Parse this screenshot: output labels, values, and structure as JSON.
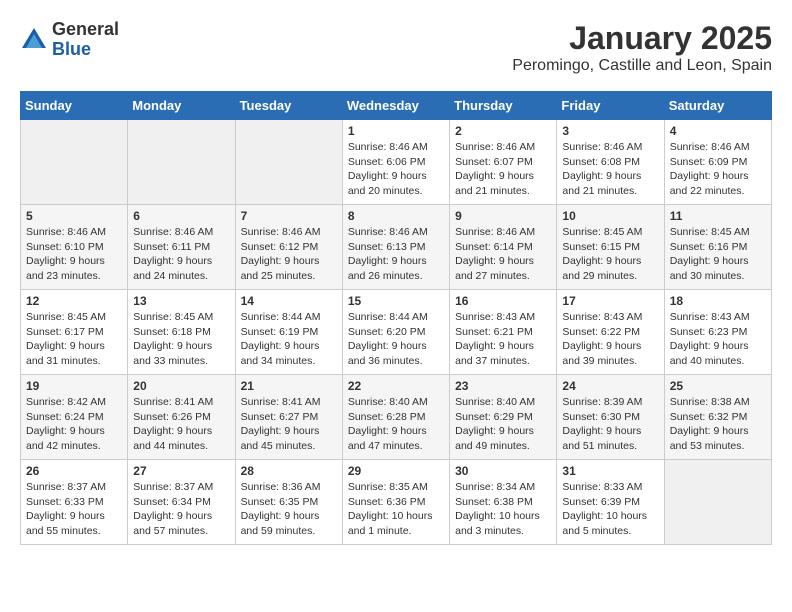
{
  "header": {
    "logo_general": "General",
    "logo_blue": "Blue",
    "month_title": "January 2025",
    "location": "Peromingo, Castille and Leon, Spain"
  },
  "weekdays": [
    "Sunday",
    "Monday",
    "Tuesday",
    "Wednesday",
    "Thursday",
    "Friday",
    "Saturday"
  ],
  "weeks": [
    [
      {
        "day": "",
        "sunrise": "",
        "sunset": "",
        "daylight": "",
        "empty": true
      },
      {
        "day": "",
        "sunrise": "",
        "sunset": "",
        "daylight": "",
        "empty": true
      },
      {
        "day": "",
        "sunrise": "",
        "sunset": "",
        "daylight": "",
        "empty": true
      },
      {
        "day": "1",
        "sunrise": "Sunrise: 8:46 AM",
        "sunset": "Sunset: 6:06 PM",
        "daylight": "Daylight: 9 hours and 20 minutes.",
        "empty": false
      },
      {
        "day": "2",
        "sunrise": "Sunrise: 8:46 AM",
        "sunset": "Sunset: 6:07 PM",
        "daylight": "Daylight: 9 hours and 21 minutes.",
        "empty": false
      },
      {
        "day": "3",
        "sunrise": "Sunrise: 8:46 AM",
        "sunset": "Sunset: 6:08 PM",
        "daylight": "Daylight: 9 hours and 21 minutes.",
        "empty": false
      },
      {
        "day": "4",
        "sunrise": "Sunrise: 8:46 AM",
        "sunset": "Sunset: 6:09 PM",
        "daylight": "Daylight: 9 hours and 22 minutes.",
        "empty": false
      }
    ],
    [
      {
        "day": "5",
        "sunrise": "Sunrise: 8:46 AM",
        "sunset": "Sunset: 6:10 PM",
        "daylight": "Daylight: 9 hours and 23 minutes.",
        "empty": false
      },
      {
        "day": "6",
        "sunrise": "Sunrise: 8:46 AM",
        "sunset": "Sunset: 6:11 PM",
        "daylight": "Daylight: 9 hours and 24 minutes.",
        "empty": false
      },
      {
        "day": "7",
        "sunrise": "Sunrise: 8:46 AM",
        "sunset": "Sunset: 6:12 PM",
        "daylight": "Daylight: 9 hours and 25 minutes.",
        "empty": false
      },
      {
        "day": "8",
        "sunrise": "Sunrise: 8:46 AM",
        "sunset": "Sunset: 6:13 PM",
        "daylight": "Daylight: 9 hours and 26 minutes.",
        "empty": false
      },
      {
        "day": "9",
        "sunrise": "Sunrise: 8:46 AM",
        "sunset": "Sunset: 6:14 PM",
        "daylight": "Daylight: 9 hours and 27 minutes.",
        "empty": false
      },
      {
        "day": "10",
        "sunrise": "Sunrise: 8:45 AM",
        "sunset": "Sunset: 6:15 PM",
        "daylight": "Daylight: 9 hours and 29 minutes.",
        "empty": false
      },
      {
        "day": "11",
        "sunrise": "Sunrise: 8:45 AM",
        "sunset": "Sunset: 6:16 PM",
        "daylight": "Daylight: 9 hours and 30 minutes.",
        "empty": false
      }
    ],
    [
      {
        "day": "12",
        "sunrise": "Sunrise: 8:45 AM",
        "sunset": "Sunset: 6:17 PM",
        "daylight": "Daylight: 9 hours and 31 minutes.",
        "empty": false
      },
      {
        "day": "13",
        "sunrise": "Sunrise: 8:45 AM",
        "sunset": "Sunset: 6:18 PM",
        "daylight": "Daylight: 9 hours and 33 minutes.",
        "empty": false
      },
      {
        "day": "14",
        "sunrise": "Sunrise: 8:44 AM",
        "sunset": "Sunset: 6:19 PM",
        "daylight": "Daylight: 9 hours and 34 minutes.",
        "empty": false
      },
      {
        "day": "15",
        "sunrise": "Sunrise: 8:44 AM",
        "sunset": "Sunset: 6:20 PM",
        "daylight": "Daylight: 9 hours and 36 minutes.",
        "empty": false
      },
      {
        "day": "16",
        "sunrise": "Sunrise: 8:43 AM",
        "sunset": "Sunset: 6:21 PM",
        "daylight": "Daylight: 9 hours and 37 minutes.",
        "empty": false
      },
      {
        "day": "17",
        "sunrise": "Sunrise: 8:43 AM",
        "sunset": "Sunset: 6:22 PM",
        "daylight": "Daylight: 9 hours and 39 minutes.",
        "empty": false
      },
      {
        "day": "18",
        "sunrise": "Sunrise: 8:43 AM",
        "sunset": "Sunset: 6:23 PM",
        "daylight": "Daylight: 9 hours and 40 minutes.",
        "empty": false
      }
    ],
    [
      {
        "day": "19",
        "sunrise": "Sunrise: 8:42 AM",
        "sunset": "Sunset: 6:24 PM",
        "daylight": "Daylight: 9 hours and 42 minutes.",
        "empty": false
      },
      {
        "day": "20",
        "sunrise": "Sunrise: 8:41 AM",
        "sunset": "Sunset: 6:26 PM",
        "daylight": "Daylight: 9 hours and 44 minutes.",
        "empty": false
      },
      {
        "day": "21",
        "sunrise": "Sunrise: 8:41 AM",
        "sunset": "Sunset: 6:27 PM",
        "daylight": "Daylight: 9 hours and 45 minutes.",
        "empty": false
      },
      {
        "day": "22",
        "sunrise": "Sunrise: 8:40 AM",
        "sunset": "Sunset: 6:28 PM",
        "daylight": "Daylight: 9 hours and 47 minutes.",
        "empty": false
      },
      {
        "day": "23",
        "sunrise": "Sunrise: 8:40 AM",
        "sunset": "Sunset: 6:29 PM",
        "daylight": "Daylight: 9 hours and 49 minutes.",
        "empty": false
      },
      {
        "day": "24",
        "sunrise": "Sunrise: 8:39 AM",
        "sunset": "Sunset: 6:30 PM",
        "daylight": "Daylight: 9 hours and 51 minutes.",
        "empty": false
      },
      {
        "day": "25",
        "sunrise": "Sunrise: 8:38 AM",
        "sunset": "Sunset: 6:32 PM",
        "daylight": "Daylight: 9 hours and 53 minutes.",
        "empty": false
      }
    ],
    [
      {
        "day": "26",
        "sunrise": "Sunrise: 8:37 AM",
        "sunset": "Sunset: 6:33 PM",
        "daylight": "Daylight: 9 hours and 55 minutes.",
        "empty": false
      },
      {
        "day": "27",
        "sunrise": "Sunrise: 8:37 AM",
        "sunset": "Sunset: 6:34 PM",
        "daylight": "Daylight: 9 hours and 57 minutes.",
        "empty": false
      },
      {
        "day": "28",
        "sunrise": "Sunrise: 8:36 AM",
        "sunset": "Sunset: 6:35 PM",
        "daylight": "Daylight: 9 hours and 59 minutes.",
        "empty": false
      },
      {
        "day": "29",
        "sunrise": "Sunrise: 8:35 AM",
        "sunset": "Sunset: 6:36 PM",
        "daylight": "Daylight: 10 hours and 1 minute.",
        "empty": false
      },
      {
        "day": "30",
        "sunrise": "Sunrise: 8:34 AM",
        "sunset": "Sunset: 6:38 PM",
        "daylight": "Daylight: 10 hours and 3 minutes.",
        "empty": false
      },
      {
        "day": "31",
        "sunrise": "Sunrise: 8:33 AM",
        "sunset": "Sunset: 6:39 PM",
        "daylight": "Daylight: 10 hours and 5 minutes.",
        "empty": false
      },
      {
        "day": "",
        "sunrise": "",
        "sunset": "",
        "daylight": "",
        "empty": true
      }
    ]
  ]
}
